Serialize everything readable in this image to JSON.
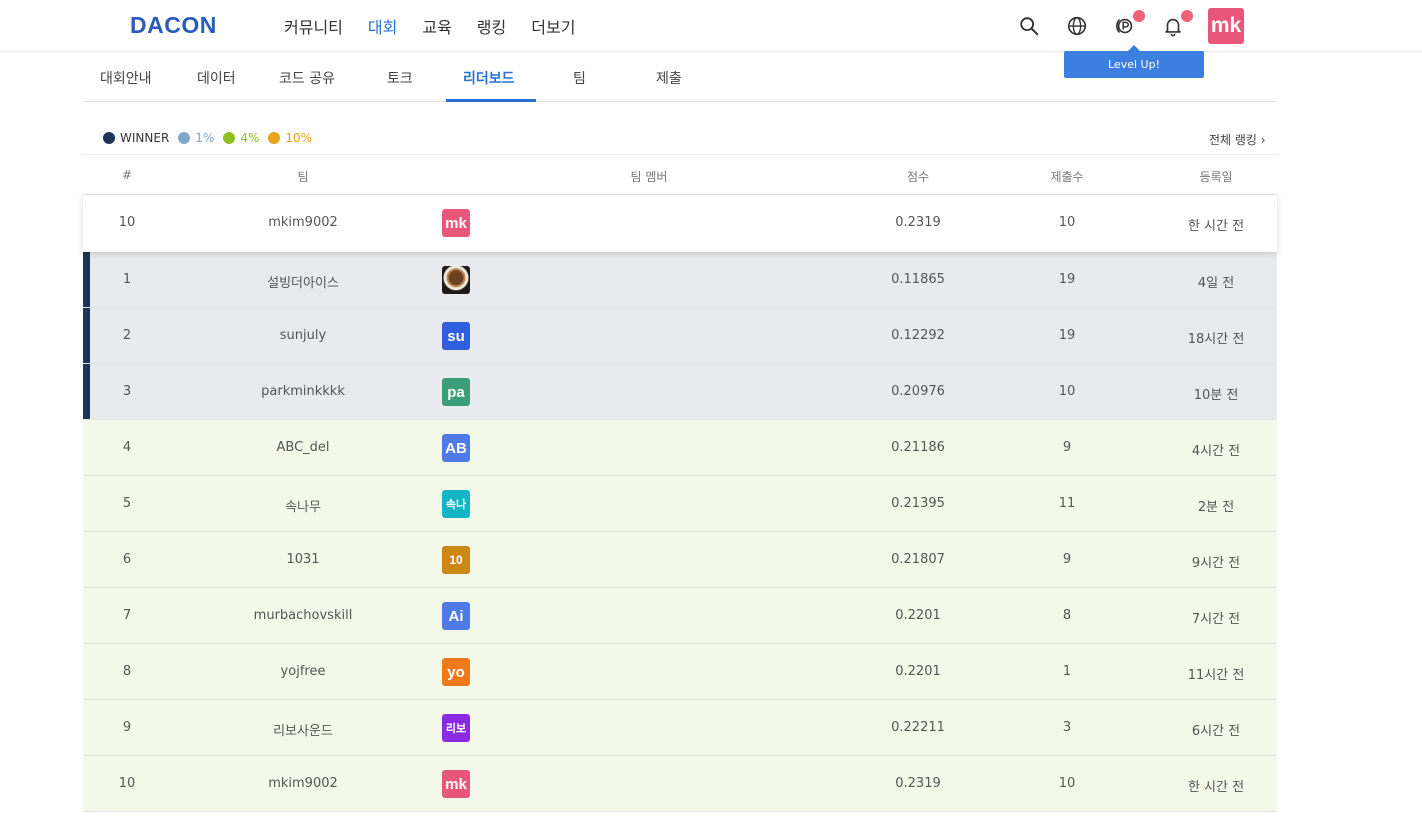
{
  "header": {
    "logo": "DACON",
    "nav": [
      "커뮤니티",
      "대회",
      "교육",
      "랭킹",
      "더보기"
    ],
    "active_nav": "대회",
    "avatar": "mk",
    "tooltip": "Level Up!",
    "icons": [
      "search-icon",
      "globe-icon",
      "point-icon",
      "bell-icon"
    ]
  },
  "tabs": [
    "대회안내",
    "데이터",
    "코드 공유",
    "토크",
    "리더보드",
    "팀",
    "제출"
  ],
  "active_tab": "리더보드",
  "legend": {
    "winner": "WINNER",
    "p1": "1%",
    "p4": "4%",
    "p10": "10%",
    "all_ranking": "전체 랭킹 ›"
  },
  "colors": {
    "winner": "#1f3557",
    "p1": "#7ea8c9",
    "p4": "#8fbf24",
    "p10": "#e8a317",
    "accent": "#2a6fd6"
  },
  "table": {
    "headers": [
      "#",
      "팀",
      "팀 멤버",
      "점수",
      "제출수",
      "등록일"
    ],
    "my_row": {
      "rank": "10",
      "team": "mkim9002",
      "member": "mk",
      "member_color": "#e8577a",
      "score": "0.2319",
      "submissions": "10",
      "date": "한 시간 전"
    },
    "rows": [
      {
        "rank": "1",
        "team": "설빙더아이스",
        "member": "",
        "member_color": "photo",
        "score": "0.11865",
        "submissions": "19",
        "date": "4일 전",
        "tier": "winner"
      },
      {
        "rank": "2",
        "team": "sunjuly",
        "member": "su",
        "member_color": "#2f5fe0",
        "score": "0.12292",
        "submissions": "19",
        "date": "18시간 전",
        "tier": "winner"
      },
      {
        "rank": "3",
        "team": "parkminkkkk",
        "member": "pa",
        "member_color": "#3a9e78",
        "score": "0.20976",
        "submissions": "10",
        "date": "10분 전",
        "tier": "winner"
      },
      {
        "rank": "4",
        "team": "ABC_del",
        "member": "AB",
        "member_color": "#4f7be8",
        "score": "0.21186",
        "submissions": "9",
        "date": "4시간 전",
        "tier": "pct"
      },
      {
        "rank": "5",
        "team": "속나무",
        "member": "속나",
        "member_color": "#12b5c4",
        "score": "0.21395",
        "submissions": "11",
        "date": "2분 전",
        "tier": "pct"
      },
      {
        "rank": "6",
        "team": "1031",
        "member": "10",
        "member_color": "#cc8714",
        "score": "0.21807",
        "submissions": "9",
        "date": "9시간 전",
        "tier": "pct"
      },
      {
        "rank": "7",
        "team": "murbachovskill",
        "member": "Ai",
        "member_color": "#4f7be8",
        "score": "0.2201",
        "submissions": "8",
        "date": "7시간 전",
        "tier": "pct"
      },
      {
        "rank": "8",
        "team": "yojfree",
        "member": "yo",
        "member_color": "#f07a1a",
        "score": "0.2201",
        "submissions": "1",
        "date": "11시간 전",
        "tier": "pct"
      },
      {
        "rank": "9",
        "team": "리보사운드",
        "member": "리보",
        "member_color": "#8a2be2",
        "score": "0.22211",
        "submissions": "3",
        "date": "6시간 전",
        "tier": "pct"
      },
      {
        "rank": "10",
        "team": "mkim9002",
        "member": "mk",
        "member_color": "#e8577a",
        "score": "0.2319",
        "submissions": "10",
        "date": "한 시간 전",
        "tier": "pct"
      }
    ]
  }
}
